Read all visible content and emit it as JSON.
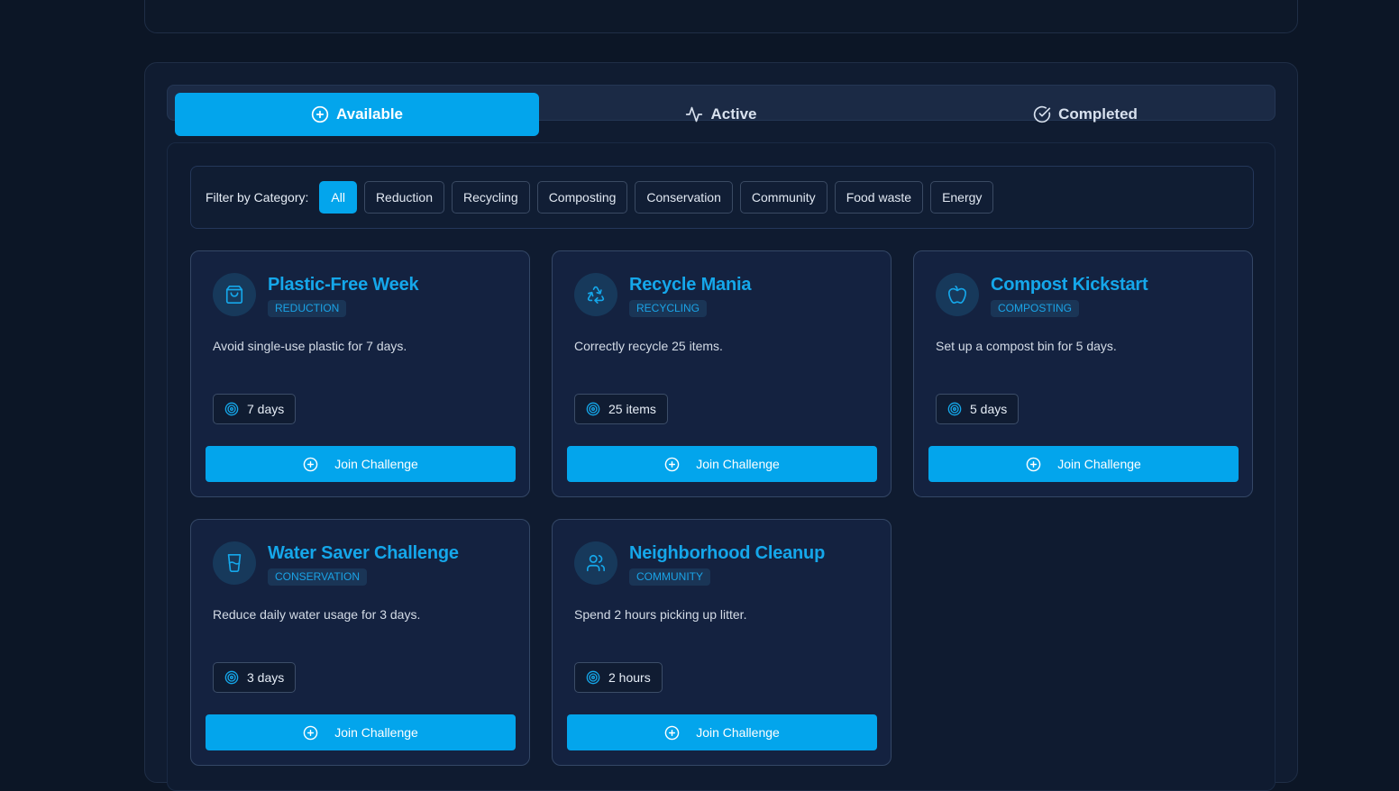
{
  "tabs": [
    {
      "label": "Available",
      "icon": "plus-circle-icon",
      "active": true
    },
    {
      "label": "Active",
      "icon": "activity-icon",
      "active": false
    },
    {
      "label": "Completed",
      "icon": "check-circle-icon",
      "active": false
    }
  ],
  "filter": {
    "label": "Filter by Category:",
    "chips": [
      "All",
      "Reduction",
      "Recycling",
      "Composting",
      "Conservation",
      "Community",
      "Food waste",
      "Energy"
    ],
    "selected": "All"
  },
  "colors": {
    "accent": "#03a5ec",
    "background": "#0c1626",
    "card": "#142240",
    "title": "#15a7ea"
  },
  "cards": [
    {
      "title": "Plastic-Free Week",
      "category": "REDUCTION",
      "icon": "shopping-bag-icon",
      "description": "Avoid single-use plastic for 7 days.",
      "goal": "7 days",
      "button": "Join Challenge"
    },
    {
      "title": "Recycle Mania",
      "category": "RECYCLING",
      "icon": "recycle-icon",
      "description": "Correctly recycle 25 items.",
      "goal": "25 items",
      "button": "Join Challenge"
    },
    {
      "title": "Compost Kickstart",
      "category": "COMPOSTING",
      "icon": "apple-icon",
      "description": "Set up a compost bin for 5 days.",
      "goal": "5 days",
      "button": "Join Challenge"
    },
    {
      "title": "Water Saver Challenge",
      "category": "CONSERVATION",
      "icon": "glass-water-icon",
      "description": "Reduce daily water usage for 3 days.",
      "goal": "3 days",
      "button": "Join Challenge"
    },
    {
      "title": "Neighborhood Cleanup",
      "category": "COMMUNITY",
      "icon": "users-icon",
      "description": "Spend 2 hours picking up litter.",
      "goal": "2 hours",
      "button": "Join Challenge"
    }
  ]
}
